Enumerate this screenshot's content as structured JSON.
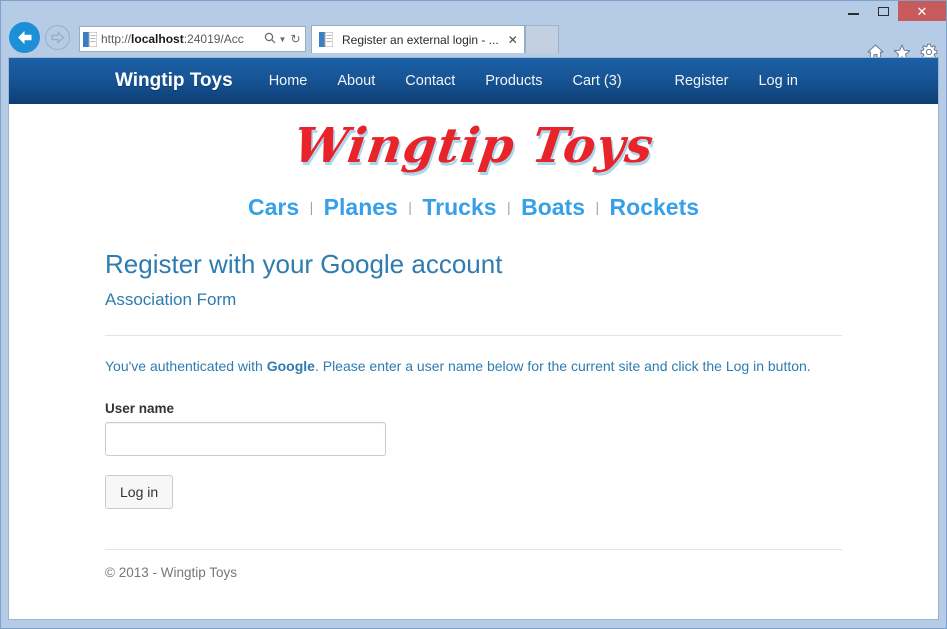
{
  "browser": {
    "window_controls": {
      "minimize": "–",
      "maximize": "☐",
      "close": "✕"
    },
    "back_label": "Back",
    "forward_label": "Forward",
    "address": {
      "url_prefix": "http://",
      "url_host": "localhost",
      "url_suffix": ":24019/Acc",
      "search_icon": "search-icon",
      "dropdown_icon": "chevron-down-icon",
      "refresh_icon": "refresh-icon",
      "refresh_glyph": "↻"
    },
    "tab": {
      "title": "Register an external login - ...",
      "close_glyph": "✕"
    },
    "icons": {
      "home": "home-icon",
      "favorites": "star-icon",
      "settings": "gear-icon"
    }
  },
  "site": {
    "brand": "Wingtip Toys",
    "nav_left": [
      {
        "label": "Home"
      },
      {
        "label": "About"
      },
      {
        "label": "Contact"
      },
      {
        "label": "Products"
      },
      {
        "label": "Cart (3)"
      }
    ],
    "nav_right": [
      {
        "label": "Register"
      },
      {
        "label": "Log in"
      }
    ],
    "logo_text": "Wingtip Toys",
    "logo_color": "#e8232a",
    "logo_shadow_color": "#a9d8ee",
    "categories": [
      {
        "label": "Cars"
      },
      {
        "label": "Planes"
      },
      {
        "label": "Trucks"
      },
      {
        "label": "Boats"
      },
      {
        "label": "Rockets"
      }
    ],
    "category_separator": "|",
    "category_color": "#36a0e8",
    "accent_color": "#2e7cb0",
    "navbar_color": "#175596"
  },
  "main": {
    "title": "Register with your Google account",
    "subtitle": "Association Form",
    "intro_before": "You've authenticated with ",
    "intro_bold": "Google",
    "intro_after": ". Please enter a user name below for the current site and click the Log in button.",
    "form": {
      "username_label": "User name",
      "username_value": "",
      "username_placeholder": "",
      "submit_label": "Log in"
    }
  },
  "footer": {
    "copyright": "© 2013 - Wingtip Toys"
  }
}
